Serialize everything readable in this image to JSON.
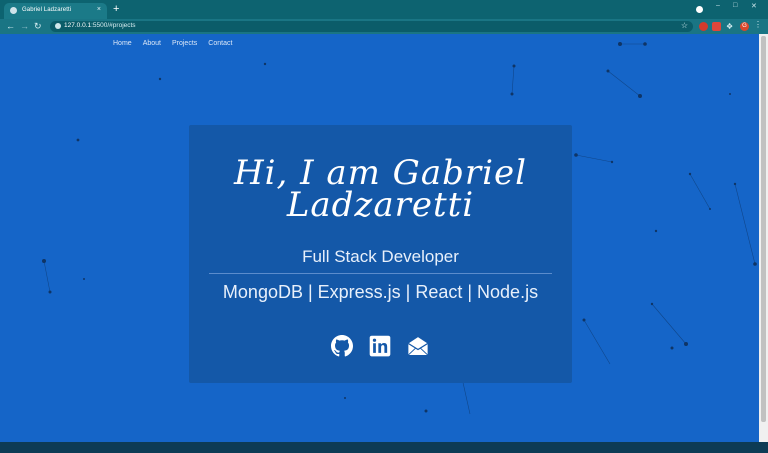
{
  "browser": {
    "tab_title": "Gabriel Ladzaretti",
    "tab_close": "×",
    "new_tab": "+",
    "url_host": "127.0.0.1",
    "url_rest": ":5500/#projects",
    "avatar_letter": "G"
  },
  "nav": {
    "home": "Home",
    "about": "About",
    "projects": "Projects",
    "contact": "Contact"
  },
  "hero": {
    "title_line1": "Hi, I am Gabriel",
    "title_line2": "Ladzaretti",
    "role": "Full Stack Developer",
    "stack": "MongoDB | Express.js | React | Node.js"
  },
  "social": {
    "github_icon": "github-icon",
    "linkedin_icon": "linkedin-icon",
    "email_icon": "envelope-icon"
  },
  "colors": {
    "page_bg": "#1565c8",
    "card_bg": "#1458a8",
    "browser_frame": "#0d6370"
  }
}
